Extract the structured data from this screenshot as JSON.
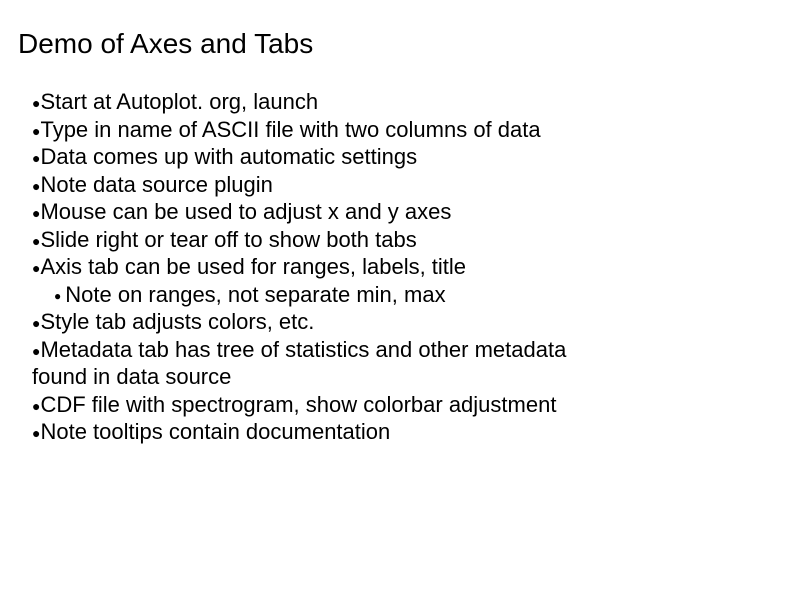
{
  "title": "Demo of Axes and Tabs",
  "bullet_glyph": "●",
  "items": {
    "i0": "Start at Autoplot. org, launch",
    "i1": "Type in name of ASCII file with two columns of data",
    "i2": "Data comes up with automatic settings",
    "i3": "Note data source plugin",
    "i4": "Mouse can be used to adjust x and y axes",
    "i5": "Slide right or tear off to show both tabs",
    "i6": "Axis tab can be used for ranges, labels, title",
    "i6_sub": "Note on ranges, not separate min, max",
    "i7": "Style tab adjusts colors, etc.",
    "i8a": "Metadata tab has tree of statistics and other metadata",
    "i8b": "found in data source",
    "i9": "CDF file with spectrogram, show colorbar adjustment",
    "i10": "Note tooltips contain documentation"
  }
}
